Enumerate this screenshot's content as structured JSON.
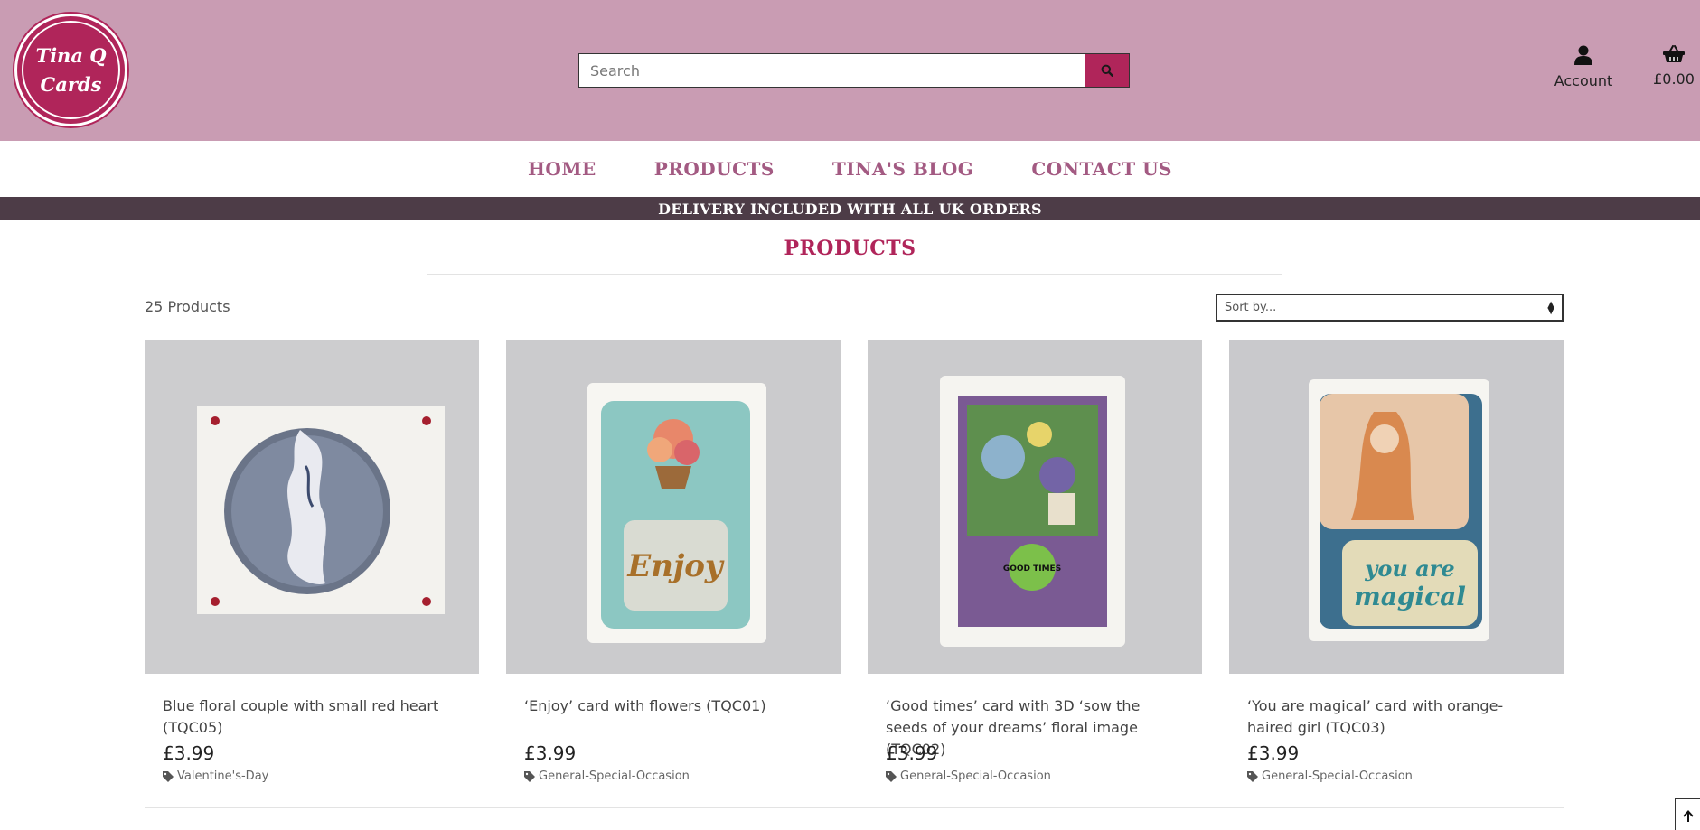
{
  "logo": {
    "line1": "Tina Q",
    "line2": "Cards"
  },
  "search": {
    "placeholder": "Search",
    "value": "",
    "button_icon": "search-icon"
  },
  "header": {
    "account_label": "Account",
    "account_icon": "user-icon",
    "basket_total": "£0.00",
    "basket_icon": "basket-icon"
  },
  "nav": {
    "items": [
      {
        "label": "HOME"
      },
      {
        "label": "PRODUCTS"
      },
      {
        "label": "TINA'S BLOG"
      },
      {
        "label": "CONTACT US"
      }
    ]
  },
  "banner": {
    "text": "DELIVERY INCLUDED WITH ALL UK ORDERS"
  },
  "page": {
    "title": "PRODUCTS",
    "count": "25 Products",
    "sort_label": "Sort by..."
  },
  "products": [
    {
      "title": "Blue floral couple with small red heart (TQC05)",
      "price": "£3.99",
      "category": "Valentine's-Day"
    },
    {
      "title": "‘Enjoy’ card with flowers (TQC01)",
      "price": "£3.99",
      "category": "General-Special-Occasion",
      "image_text": "Enjoy"
    },
    {
      "title": "‘Good times’ card with 3D ‘sow the seeds of your dreams’ floral image (TQC02)",
      "price": "£3.99",
      "category": "General-Special-Occasion",
      "image_text": "GOOD TIMES"
    },
    {
      "title": "‘You are magical’ card with orange-haired girl (TQC03)",
      "price": "£3.99",
      "category": "General-Special-Occasion",
      "image_text_1": "you are",
      "image_text_2": "magical"
    }
  ],
  "colors": {
    "brand": "#b0255a",
    "header_bg": "#c99cb3",
    "nav_text": "#a35a82",
    "banner_bg": "#4d3c47"
  }
}
